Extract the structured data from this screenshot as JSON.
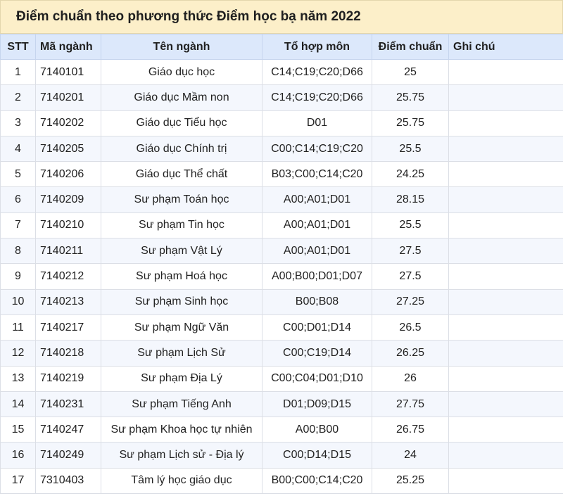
{
  "title": "Điểm chuẩn theo phương thức Điểm học bạ năm 2022",
  "colors": {
    "title_bg": "#fcefc9",
    "header_bg": "#dce8fb",
    "stripe_bg": "#f4f7fd",
    "border": "#dcdfe6"
  },
  "table": {
    "headers": {
      "stt": "STT",
      "ma_nganh": "Mã ngành",
      "ten_nganh": "Tên ngành",
      "to_hop_mon": "Tổ hợp môn",
      "diem_chuan": "Điểm chuẩn",
      "ghi_chu": "Ghi chú"
    },
    "rows": [
      {
        "stt": "1",
        "ma_nganh": "7140101",
        "ten_nganh": "Giáo dục học",
        "to_hop_mon": "C14;C19;C20;D66",
        "diem_chuan": "25",
        "ghi_chu": ""
      },
      {
        "stt": "2",
        "ma_nganh": "7140201",
        "ten_nganh": "Giáo dục Mầm non",
        "to_hop_mon": "C14;C19;C20;D66",
        "diem_chuan": "25.75",
        "ghi_chu": ""
      },
      {
        "stt": "3",
        "ma_nganh": "7140202",
        "ten_nganh": "Giáo dục Tiểu học",
        "to_hop_mon": "D01",
        "diem_chuan": "25.75",
        "ghi_chu": ""
      },
      {
        "stt": "4",
        "ma_nganh": "7140205",
        "ten_nganh": "Giáo dục Chính trị",
        "to_hop_mon": "C00;C14;C19;C20",
        "diem_chuan": "25.5",
        "ghi_chu": ""
      },
      {
        "stt": "5",
        "ma_nganh": "7140206",
        "ten_nganh": "Giáo dục Thể chất",
        "to_hop_mon": "B03;C00;C14;C20",
        "diem_chuan": "24.25",
        "ghi_chu": ""
      },
      {
        "stt": "6",
        "ma_nganh": "7140209",
        "ten_nganh": "Sư phạm Toán học",
        "to_hop_mon": "A00;A01;D01",
        "diem_chuan": "28.15",
        "ghi_chu": ""
      },
      {
        "stt": "7",
        "ma_nganh": "7140210",
        "ten_nganh": "Sư phạm Tin học",
        "to_hop_mon": "A00;A01;D01",
        "diem_chuan": "25.5",
        "ghi_chu": ""
      },
      {
        "stt": "8",
        "ma_nganh": "7140211",
        "ten_nganh": "Sư phạm Vật Lý",
        "to_hop_mon": "A00;A01;D01",
        "diem_chuan": "27.5",
        "ghi_chu": ""
      },
      {
        "stt": "9",
        "ma_nganh": "7140212",
        "ten_nganh": "Sư phạm Hoá học",
        "to_hop_mon": "A00;B00;D01;D07",
        "diem_chuan": "27.5",
        "ghi_chu": ""
      },
      {
        "stt": "10",
        "ma_nganh": "7140213",
        "ten_nganh": "Sư phạm Sinh học",
        "to_hop_mon": "B00;B08",
        "diem_chuan": "27.25",
        "ghi_chu": ""
      },
      {
        "stt": "11",
        "ma_nganh": "7140217",
        "ten_nganh": "Sư phạm Ngữ Văn",
        "to_hop_mon": "C00;D01;D14",
        "diem_chuan": "26.5",
        "ghi_chu": ""
      },
      {
        "stt": "12",
        "ma_nganh": "7140218",
        "ten_nganh": "Sư phạm Lịch Sử",
        "to_hop_mon": "C00;C19;D14",
        "diem_chuan": "26.25",
        "ghi_chu": ""
      },
      {
        "stt": "13",
        "ma_nganh": "7140219",
        "ten_nganh": "Sư phạm Địa Lý",
        "to_hop_mon": "C00;C04;D01;D10",
        "diem_chuan": "26",
        "ghi_chu": ""
      },
      {
        "stt": "14",
        "ma_nganh": "7140231",
        "ten_nganh": "Sư phạm Tiếng Anh",
        "to_hop_mon": "D01;D09;D15",
        "diem_chuan": "27.75",
        "ghi_chu": ""
      },
      {
        "stt": "15",
        "ma_nganh": "7140247",
        "ten_nganh": "Sư phạm Khoa học tự nhiên",
        "to_hop_mon": "A00;B00",
        "diem_chuan": "26.75",
        "ghi_chu": ""
      },
      {
        "stt": "16",
        "ma_nganh": "7140249",
        "ten_nganh": "Sư phạm Lịch sử - Địa lý",
        "to_hop_mon": "C00;D14;D15",
        "diem_chuan": "24",
        "ghi_chu": ""
      },
      {
        "stt": "17",
        "ma_nganh": "7310403",
        "ten_nganh": "Tâm lý học giáo dục",
        "to_hop_mon": "B00;C00;C14;C20",
        "diem_chuan": "25.25",
        "ghi_chu": ""
      }
    ]
  }
}
